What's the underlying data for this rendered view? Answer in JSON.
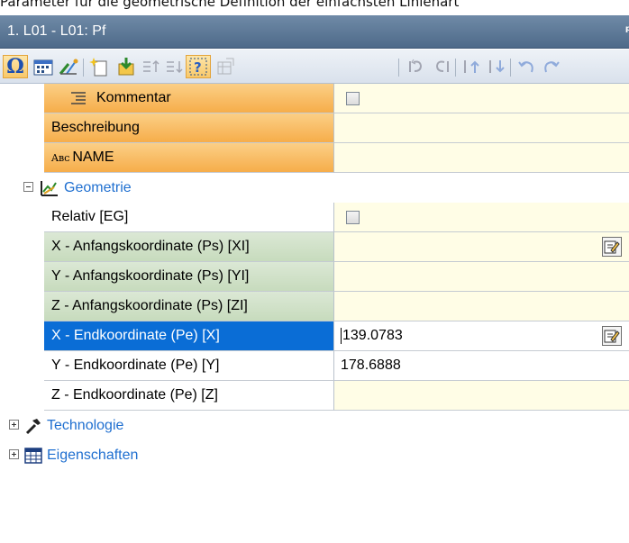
{
  "caption": "Parameter für die geometrische Definition der einfachsten Linienart",
  "panel": {
    "title": "1. L01 - L01: Pf",
    "pin_icon": "pin-icon"
  },
  "toolbar": {
    "icons": [
      "omega-icon",
      "calendar-icon",
      "tools-icon",
      "new-sparkle-icon",
      "import-icon",
      "sort-up-icon",
      "sort-down-icon",
      "help-select-icon",
      "grid-disabled-icon",
      "undo-icon",
      "redo-icon",
      "move-up-icon",
      "move-down-icon",
      "rotate-left-icon",
      "rotate-right-icon"
    ]
  },
  "rows": {
    "kommentar": {
      "label": "Kommentar"
    },
    "beschreibung": {
      "label": "Beschreibung"
    },
    "name": {
      "label": "NAME",
      "prefix": "Aʙᴄ"
    },
    "geometrie": {
      "label": "Geometrie"
    },
    "relativ": {
      "label": "Relativ [EG]"
    },
    "x_start": {
      "label": "X - Anfangskoordinate (Ps) [XI]"
    },
    "y_start": {
      "label": "Y - Anfangskoordinate (Ps) [YI]"
    },
    "z_start": {
      "label": "Z - Anfangskoordinate (Ps) [ZI]"
    },
    "x_end": {
      "label": "X - Endkoordinate (Pe) [X]",
      "value": "139.0783"
    },
    "y_end": {
      "label": "Y - Endkoordinate (Pe) [Y]",
      "value": "178.6888"
    },
    "z_end": {
      "label": "Z - Endkoordinate (Pe) [Z]"
    },
    "technologie": {
      "label": "Technologie"
    },
    "eigenschaften": {
      "label": "Eigenschaften"
    }
  },
  "colors": {
    "header": "#5a7594",
    "orange": "#f6ad4a",
    "green": "#c7dbbd",
    "selected": "#0a6dd6",
    "value_bg": "#fffde6",
    "group_text": "#1f6fd0"
  }
}
